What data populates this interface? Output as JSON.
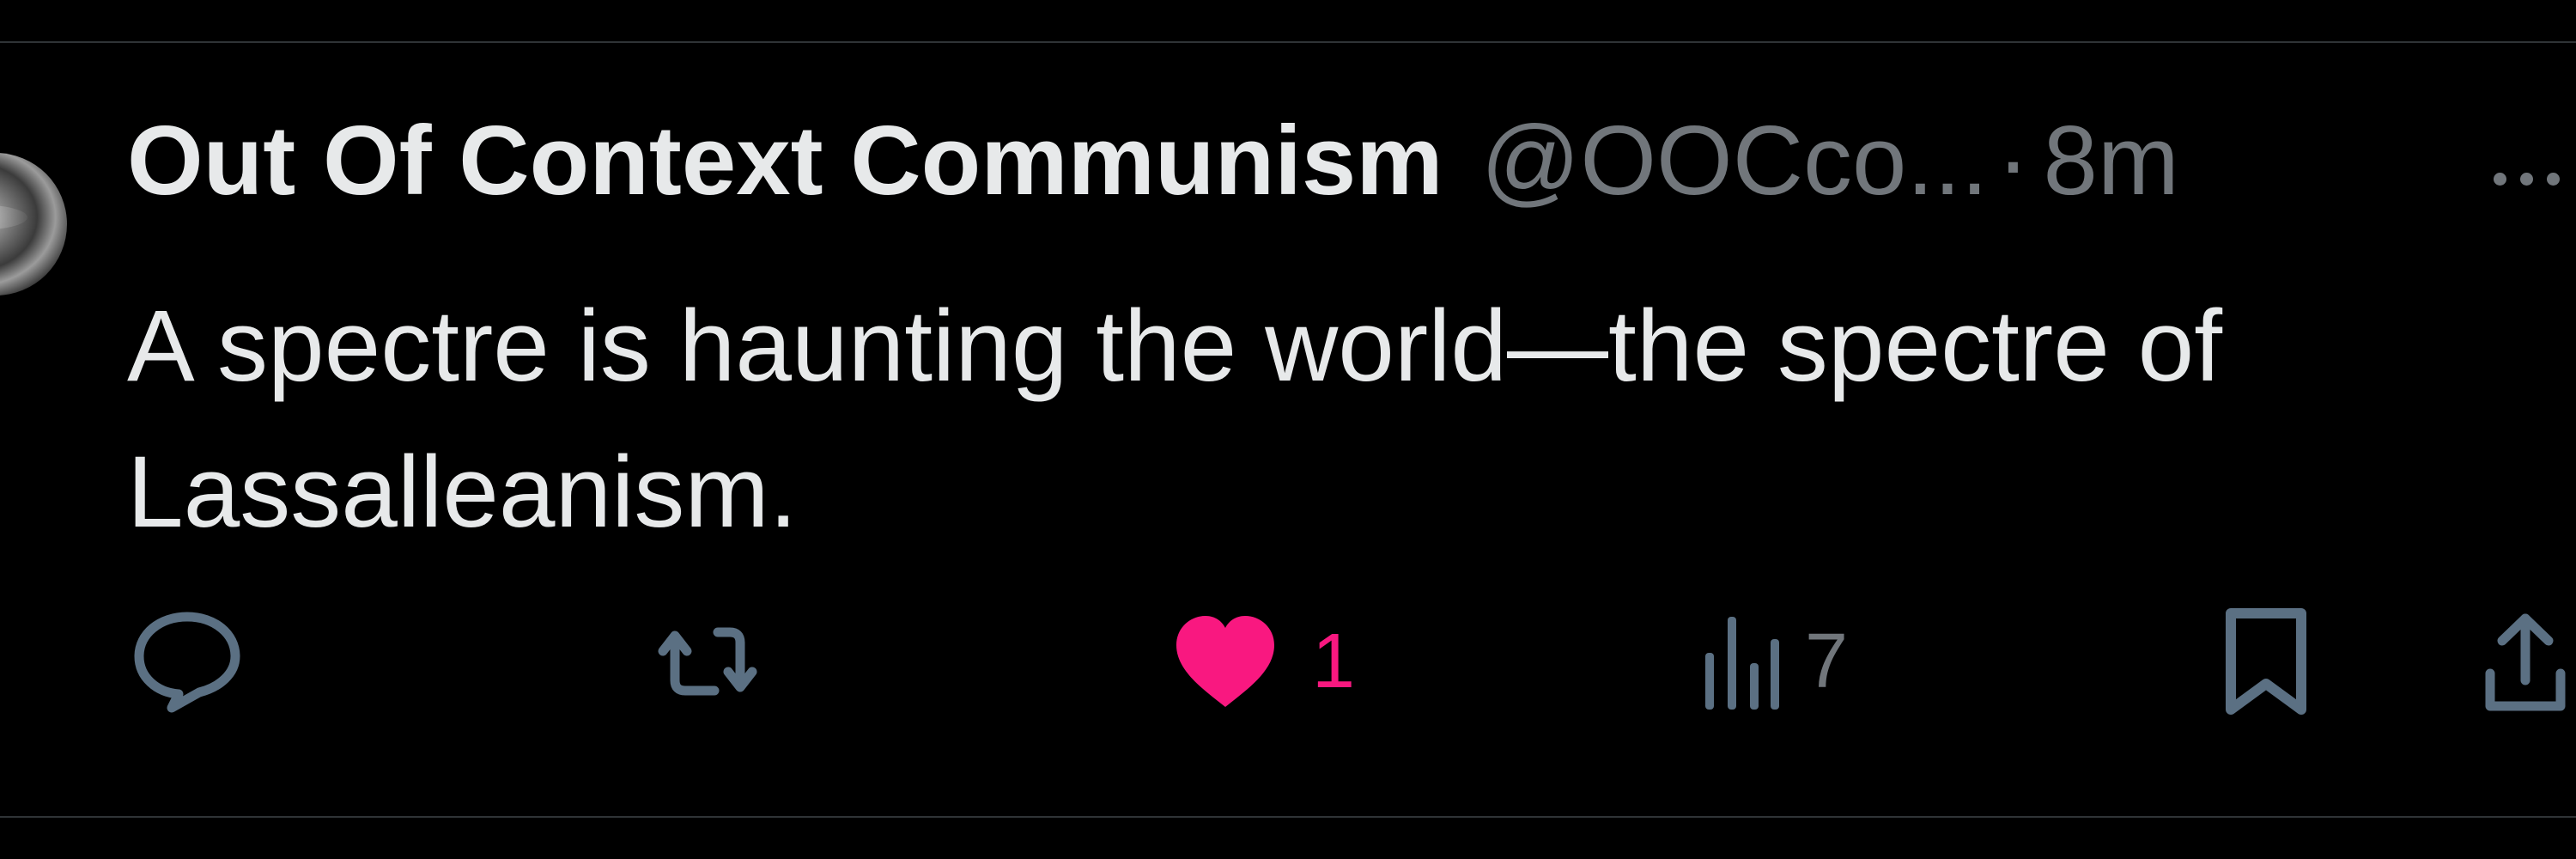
{
  "tweet": {
    "author_name": "Out Of Context Communism",
    "handle": "@OOCco...",
    "separator": "·",
    "time": "8m",
    "text_line1": "A spectre is haunting the world—the spectre of",
    "text_line2": "Lassalleanism."
  },
  "actions": {
    "reply": {
      "icon": "reply-bubble-icon"
    },
    "retweet": {
      "icon": "retweet-icon"
    },
    "like": {
      "icon": "heart-filled-icon",
      "count": "1",
      "color": "#f91880"
    },
    "views": {
      "icon": "bar-chart-icon",
      "count": "7"
    },
    "bookmark": {
      "icon": "bookmark-icon"
    },
    "share": {
      "icon": "share-icon"
    }
  },
  "colors": {
    "background": "#000000",
    "primary_text": "#e7e9ea",
    "secondary_text": "#71767b",
    "icon": "#5b7083",
    "like": "#f91880",
    "divider": "#2f3336"
  }
}
